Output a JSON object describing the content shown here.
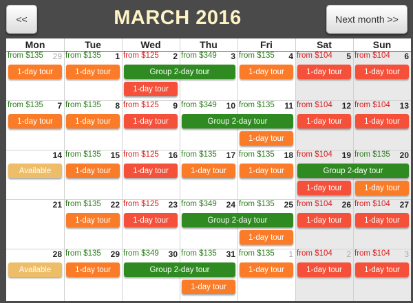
{
  "header": {
    "prev_label": "<<",
    "next_label": "Next month >>",
    "title": "MARCH 2016"
  },
  "weekdays": [
    "Mon",
    "Tue",
    "Wed",
    "Thu",
    "Fri",
    "Sat",
    "Sun"
  ],
  "colors": {
    "price_regular": "#2e7d1e",
    "price_discount": "#d81e1e",
    "tour_1day": "#fb7c28",
    "tour_1day_discount": "#f4503a",
    "tour_group": "#2e8a21",
    "available": "#eebd67"
  },
  "weeks": [
    {
      "days": [
        {
          "num": "29",
          "price": "from $135",
          "price_color": "green",
          "other_month": true
        },
        {
          "num": "1",
          "price": "from $135",
          "price_color": "green"
        },
        {
          "num": "2",
          "price": "from $125",
          "price_color": "red"
        },
        {
          "num": "3",
          "price": "from $349",
          "price_color": "green"
        },
        {
          "num": "4",
          "price": "from $135",
          "price_color": "green"
        },
        {
          "num": "5",
          "price": "from $104",
          "price_color": "red"
        },
        {
          "num": "6",
          "price": "from $104",
          "price_color": "red"
        }
      ],
      "rows": [
        [
          {
            "col": 0,
            "span": 1,
            "label": "1-day tour",
            "style": "orange"
          },
          {
            "col": 1,
            "span": 1,
            "label": "1-day tour",
            "style": "orange"
          },
          {
            "col": 2,
            "span": 2,
            "label": "Group 2-day tour",
            "style": "green"
          },
          {
            "col": 4,
            "span": 1,
            "label": "1-day tour",
            "style": "orange"
          },
          {
            "col": 5,
            "span": 1,
            "label": "1-day tour",
            "style": "red"
          },
          {
            "col": 6,
            "span": 1,
            "label": "1-day tour",
            "style": "red"
          }
        ],
        [
          {
            "col": 2,
            "span": 1,
            "label": "1-day tour",
            "style": "red"
          }
        ]
      ]
    },
    {
      "days": [
        {
          "num": "7",
          "price": "from $135",
          "price_color": "green"
        },
        {
          "num": "8",
          "price": "from $135",
          "price_color": "green"
        },
        {
          "num": "9",
          "price": "from $125",
          "price_color": "red"
        },
        {
          "num": "10",
          "price": "from $349",
          "price_color": "green"
        },
        {
          "num": "11",
          "price": "from $135",
          "price_color": "green"
        },
        {
          "num": "12",
          "price": "from $104",
          "price_color": "red"
        },
        {
          "num": "13",
          "price": "from $104",
          "price_color": "red"
        }
      ],
      "rows": [
        [
          {
            "col": 0,
            "span": 1,
            "label": "1-day tour",
            "style": "orange"
          },
          {
            "col": 1,
            "span": 1,
            "label": "1-day tour",
            "style": "orange"
          },
          {
            "col": 2,
            "span": 1,
            "label": "1-day tour",
            "style": "red"
          },
          {
            "col": 3,
            "span": 2,
            "label": "Group 2-day tour",
            "style": "green"
          },
          {
            "col": 5,
            "span": 1,
            "label": "1-day tour",
            "style": "red"
          },
          {
            "col": 6,
            "span": 1,
            "label": "1-day tour",
            "style": "red"
          }
        ],
        [
          {
            "col": 4,
            "span": 1,
            "label": "1-day tour",
            "style": "orange"
          }
        ]
      ]
    },
    {
      "days": [
        {
          "num": "14",
          "price": "",
          "price_color": "green"
        },
        {
          "num": "15",
          "price": "from $135",
          "price_color": "green"
        },
        {
          "num": "16",
          "price": "from $125",
          "price_color": "red"
        },
        {
          "num": "17",
          "price": "from $135",
          "price_color": "green"
        },
        {
          "num": "18",
          "price": "from $135",
          "price_color": "green"
        },
        {
          "num": "19",
          "price": "from $104",
          "price_color": "red"
        },
        {
          "num": "20",
          "price": "from $135",
          "price_color": "green"
        }
      ],
      "rows": [
        [
          {
            "col": 0,
            "span": 1,
            "label": "Available",
            "style": "avail"
          },
          {
            "col": 1,
            "span": 1,
            "label": "1-day tour",
            "style": "orange"
          },
          {
            "col": 2,
            "span": 1,
            "label": "1-day tour",
            "style": "red"
          },
          {
            "col": 3,
            "span": 1,
            "label": "1-day tour",
            "style": "orange"
          },
          {
            "col": 4,
            "span": 1,
            "label": "1-day tour",
            "style": "orange"
          },
          {
            "col": 5,
            "span": 2,
            "label": "Group 2-day tour",
            "style": "green"
          }
        ],
        [
          {
            "col": 5,
            "span": 1,
            "label": "1-day tour",
            "style": "red"
          },
          {
            "col": 6,
            "span": 1,
            "label": "1-day tour",
            "style": "orange"
          }
        ]
      ]
    },
    {
      "days": [
        {
          "num": "21",
          "price": "",
          "price_color": "green"
        },
        {
          "num": "22",
          "price": "from $135",
          "price_color": "green"
        },
        {
          "num": "23",
          "price": "from $125",
          "price_color": "red"
        },
        {
          "num": "24",
          "price": "from $349",
          "price_color": "green"
        },
        {
          "num": "25",
          "price": "from $135",
          "price_color": "green"
        },
        {
          "num": "26",
          "price": "from $104",
          "price_color": "red"
        },
        {
          "num": "27",
          "price": "from $104",
          "price_color": "red"
        }
      ],
      "rows": [
        [
          {
            "col": 1,
            "span": 1,
            "label": "1-day tour",
            "style": "orange"
          },
          {
            "col": 2,
            "span": 1,
            "label": "1-day tour",
            "style": "red"
          },
          {
            "col": 3,
            "span": 2,
            "label": "Group 2-day tour",
            "style": "green"
          },
          {
            "col": 5,
            "span": 1,
            "label": "1-day tour",
            "style": "red"
          },
          {
            "col": 6,
            "span": 1,
            "label": "1-day tour",
            "style": "red"
          }
        ],
        [
          {
            "col": 4,
            "span": 1,
            "label": "1-day tour",
            "style": "orange"
          }
        ]
      ]
    },
    {
      "days": [
        {
          "num": "28",
          "price": "",
          "price_color": "green"
        },
        {
          "num": "29",
          "price": "from $135",
          "price_color": "green"
        },
        {
          "num": "30",
          "price": "from $349",
          "price_color": "green"
        },
        {
          "num": "31",
          "price": "from $135",
          "price_color": "green"
        },
        {
          "num": "1",
          "price": "from $135",
          "price_color": "green",
          "other_month": true
        },
        {
          "num": "2",
          "price": "from $104",
          "price_color": "red",
          "other_month": true
        },
        {
          "num": "3",
          "price": "from $104",
          "price_color": "red",
          "other_month": true
        }
      ],
      "rows": [
        [
          {
            "col": 0,
            "span": 1,
            "label": "Available",
            "style": "avail"
          },
          {
            "col": 1,
            "span": 1,
            "label": "1-day tour",
            "style": "orange"
          },
          {
            "col": 2,
            "span": 2,
            "label": "Group 2-day tour",
            "style": "green"
          },
          {
            "col": 4,
            "span": 1,
            "label": "1-day tour",
            "style": "orange"
          },
          {
            "col": 5,
            "span": 1,
            "label": "1-day tour",
            "style": "red"
          },
          {
            "col": 6,
            "span": 1,
            "label": "1-day tour",
            "style": "red"
          }
        ],
        [
          {
            "col": 3,
            "span": 1,
            "label": "1-day tour",
            "style": "orange"
          }
        ]
      ]
    }
  ]
}
